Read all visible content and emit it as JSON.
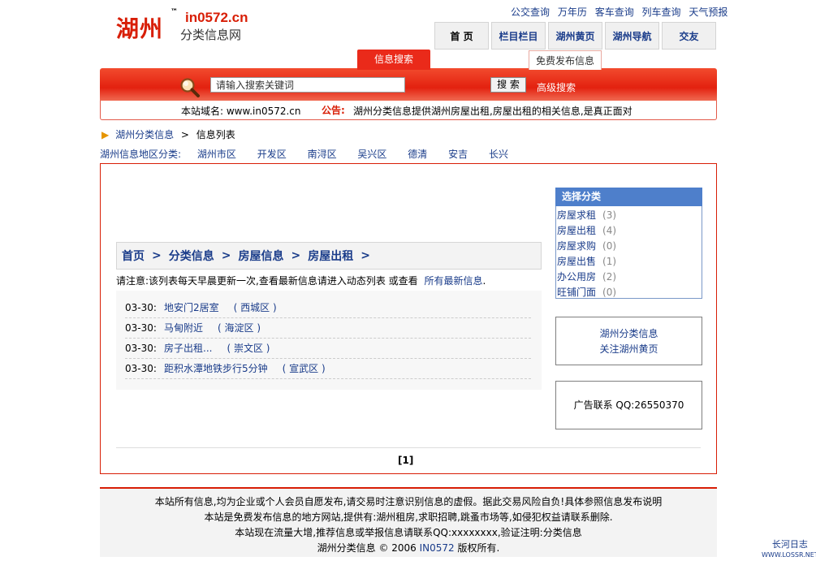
{
  "header": {
    "logo_cn": "湖州",
    "logo_tm": "™",
    "logo_site": "in0572.cn",
    "logo_sub": "分类信息网",
    "top_links": [
      "公交查询",
      "万年历",
      "客车查询",
      "列车查询",
      "天气预报"
    ],
    "nav": [
      "首 页",
      "栏目栏目",
      "湖州黄页",
      "湖州导航",
      "交友"
    ]
  },
  "search": {
    "tab_label": "信息搜索",
    "free_post_label": "免费发布信息",
    "placeholder": "请输入搜索关键词",
    "button_label": "搜 索",
    "advanced_label": "高级搜索",
    "domain_label": "本站域名: www.in0572.cn",
    "notice_label": "公告:",
    "notice_text": "湖州分类信息提供湖州房屋出租,房屋出租的相关信息,是真正面对"
  },
  "breadcrumb": {
    "home": "湖州分类信息",
    "sep": ">",
    "current": "信息列表"
  },
  "regions": {
    "label": "湖州信息地区分类:",
    "items": [
      "湖州市区",
      "开发区",
      "南浔区",
      "吴兴区",
      "德清",
      "安吉",
      "长兴"
    ]
  },
  "main": {
    "crumb": [
      "首页",
      "分类信息",
      "房屋信息",
      "房屋出租"
    ],
    "crumb_sep": ">",
    "tip_text": "请注意:该列表每天早晨更新一次,查看最新信息请进入动态列表 或查看",
    "tip_link": "所有最新信息",
    "tip_end": ".",
    "rows": [
      {
        "date": "03-30:",
        "title": "地安门2居室",
        "area": "( 西城区 )"
      },
      {
        "date": "03-30:",
        "title": "马甸附近",
        "area": "( 海淀区 )"
      },
      {
        "date": "03-30:",
        "title": "房子出租...",
        "area": "( 崇文区 )"
      },
      {
        "date": "03-30:",
        "title": "距积水潭地铁步行5分钟",
        "area": "( 宣武区 )"
      }
    ],
    "pager": "[1]"
  },
  "sidebar": {
    "cat_title": "选择分类",
    "categories": [
      {
        "name": "房屋求租",
        "count": "(3)"
      },
      {
        "name": "房屋出租",
        "count": "(4)"
      },
      {
        "name": "房屋求购",
        "count": "(0)"
      },
      {
        "name": "房屋出售",
        "count": "(1)"
      },
      {
        "name": "办公用房",
        "count": "(2)"
      },
      {
        "name": "旺铺门面",
        "count": "(0)"
      }
    ],
    "box1_line1": "湖州分类信息",
    "box1_line2": "关注湖州黄页",
    "box2_text": "广告联系 QQ:26550370"
  },
  "footer": {
    "line1": "本站所有信息,均为企业或个人会员自愿发布,请交易时注意识别信息的虚假。据此交易风险自负!具体参照信息发布说明",
    "line2": "本站是免费发布信息的地方网站,提供有:湖州租房,求职招聘,跳蚤市场等,如侵犯权益请联系删除.",
    "line3": "本站现在流量大增,推荐信息或举报信息请联系QQ:xxxxxxxx,验证注明:分类信息",
    "line4_a": "湖州分类信息 © 2006",
    "line4_link": "IN0572",
    "line4_b": "版权所有."
  },
  "watermark": {
    "line1": "长河日志",
    "line2": "WWW.LOSSR.NET"
  },
  "colors": {
    "brand_red": "#d81e06",
    "link_blue": "#1a3c8a",
    "cat_head_blue": "#4e7fcb"
  }
}
